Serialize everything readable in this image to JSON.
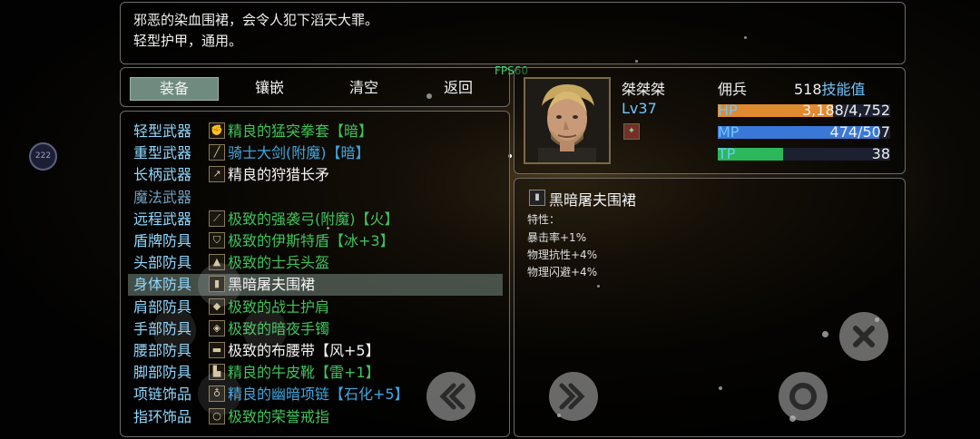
{
  "description": {
    "line1": "邪恶的染血围裙，会令人犯下滔天大罪。",
    "line2": "轻型护甲，通用。"
  },
  "fps": "FPS60",
  "tabs": [
    "装备",
    "镶嵌",
    "清空",
    "返回"
  ],
  "equipment": [
    {
      "slot": "轻型武器",
      "item": "精良的猛突拳套【暗】",
      "quality": "green",
      "icon": "gauntlet-icon"
    },
    {
      "slot": "重型武器",
      "item": "骑士大剑(附魔)【暗】",
      "quality": "blue",
      "icon": "greatsword-icon"
    },
    {
      "slot": "长柄武器",
      "item": "精良的狩猎长矛",
      "quality": "white",
      "icon": "spear-icon"
    },
    {
      "slot": "魔法武器",
      "item": "",
      "quality": "white",
      "icon": ""
    },
    {
      "slot": "远程武器",
      "item": "极致的强袭弓(附魔)【火】",
      "quality": "green",
      "icon": "bow-icon"
    },
    {
      "slot": "盾牌防具",
      "item": "极致的伊斯特盾【冰+3】",
      "quality": "green",
      "icon": "shield-icon"
    },
    {
      "slot": "头部防具",
      "item": "极致的士兵头盔",
      "quality": "green",
      "icon": "helmet-icon"
    },
    {
      "slot": "身体防具",
      "item": "黑暗屠夫围裙",
      "quality": "white",
      "icon": "apron-icon"
    },
    {
      "slot": "肩部防具",
      "item": "极致的战士护肩",
      "quality": "green",
      "icon": "pauldron-icon"
    },
    {
      "slot": "手部防具",
      "item": "极致的暗夜手镯",
      "quality": "green",
      "icon": "bracelet-icon"
    },
    {
      "slot": "腰部防具",
      "item": "极致的布腰带【风+5】",
      "quality": "white",
      "icon": "belt-icon"
    },
    {
      "slot": "脚部防具",
      "item": "精良的牛皮靴【雷+1】",
      "quality": "green",
      "icon": "boots-icon"
    },
    {
      "slot": "项链饰品",
      "item": "精良的幽暗项链【石化+5】",
      "quality": "blue",
      "icon": "necklace-icon"
    },
    {
      "slot": "指环饰品",
      "item": "极致的荣誉戒指",
      "quality": "green",
      "icon": "ring-icon"
    }
  ],
  "selected_index": 7,
  "character": {
    "name": "桀桀桀",
    "level": "Lv37",
    "class": "佣兵",
    "skill_value": "518",
    "skill_label": "技能值",
    "hp_label": "HP",
    "hp_value": "3,188/4,752",
    "hp_fraction": 0.671,
    "mp_label": "MP",
    "mp_value": "474/507",
    "mp_fraction": 0.935,
    "tp_label": "TP",
    "tp_value": "38",
    "tp_fraction": 0.38
  },
  "detail": {
    "name": "黑暗屠夫围裙",
    "trait_label": "特性：",
    "traits": [
      "暴击率+1%",
      "物理抗性+4%",
      "物理闪避+4%"
    ]
  },
  "avatar_label": "222",
  "colors": {
    "hp_bar": "#e08a30",
    "mp_bar": "#3a78d8",
    "tp_bar": "#2cb85a",
    "quality_green": "#3fc45a",
    "quality_blue": "#3fa8e0"
  }
}
